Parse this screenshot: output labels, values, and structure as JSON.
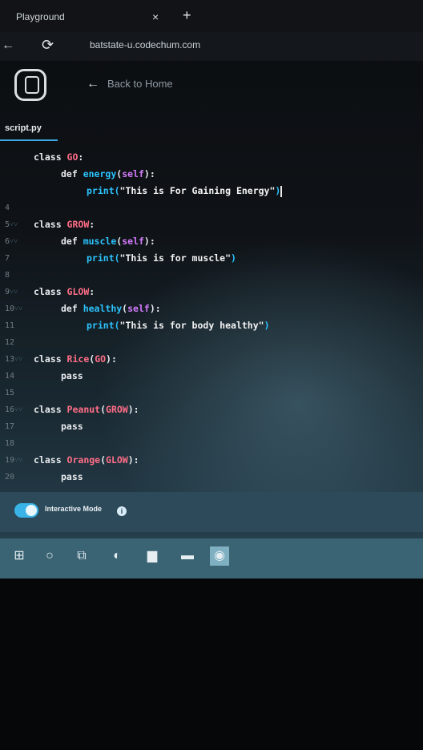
{
  "browser": {
    "tab_title": "Playground",
    "tab_close": "×",
    "new_tab": "+",
    "back": "←",
    "reload": "⟳",
    "url": "batstate-u.codechum.com"
  },
  "app": {
    "back_link_arrow": "←",
    "back_link_label": "Back to Home",
    "file_tab": "script.py"
  },
  "code_lines": [
    {
      "n": "",
      "fold": "",
      "parts": [
        {
          "t": "class ",
          "c": "kw"
        },
        {
          "t": "GO",
          "c": "cls"
        },
        {
          "t": ":",
          "c": "kw"
        }
      ],
      "indent": 0
    },
    {
      "n": "",
      "fold": "",
      "parts": [
        {
          "t": "def ",
          "c": "kw"
        },
        {
          "t": "energy",
          "c": "fn"
        },
        {
          "t": "(",
          "c": "kw"
        },
        {
          "t": "self",
          "c": "self"
        },
        {
          "t": "):",
          "c": "kw"
        }
      ],
      "indent": 1
    },
    {
      "n": "",
      "fold": "",
      "parts": [
        {
          "t": "print(",
          "c": "fn"
        },
        {
          "t": "\"This is For Gaining Energy\"",
          "c": "str"
        },
        {
          "t": ")",
          "c": "fn"
        }
      ],
      "indent": 2,
      "cursor": true
    },
    {
      "n": "4",
      "fold": "",
      "parts": [],
      "indent": 0
    },
    {
      "n": "5",
      "fold": "˅˅",
      "parts": [
        {
          "t": "class ",
          "c": "kw"
        },
        {
          "t": "GROW",
          "c": "cls"
        },
        {
          "t": ":",
          "c": "kw"
        }
      ],
      "indent": 0
    },
    {
      "n": "6",
      "fold": "˅˅",
      "parts": [
        {
          "t": "def ",
          "c": "kw"
        },
        {
          "t": "muscle",
          "c": "fn"
        },
        {
          "t": "(",
          "c": "kw"
        },
        {
          "t": "self",
          "c": "self"
        },
        {
          "t": "):",
          "c": "kw"
        }
      ],
      "indent": 1
    },
    {
      "n": "7",
      "fold": "",
      "parts": [
        {
          "t": "print(",
          "c": "fn"
        },
        {
          "t": "\"This is for muscle\"",
          "c": "str"
        },
        {
          "t": ")",
          "c": "fn"
        }
      ],
      "indent": 2
    },
    {
      "n": "8",
      "fold": "",
      "parts": [],
      "indent": 0
    },
    {
      "n": "9",
      "fold": "˅˅",
      "parts": [
        {
          "t": "class ",
          "c": "kw"
        },
        {
          "t": "GLOW",
          "c": "cls"
        },
        {
          "t": ":",
          "c": "kw"
        }
      ],
      "indent": 0
    },
    {
      "n": "10",
      "fold": "˅˅",
      "parts": [
        {
          "t": "def ",
          "c": "kw"
        },
        {
          "t": "healthy",
          "c": "fn"
        },
        {
          "t": "(",
          "c": "kw"
        },
        {
          "t": "self",
          "c": "self"
        },
        {
          "t": "):",
          "c": "kw"
        }
      ],
      "indent": 1
    },
    {
      "n": "11",
      "fold": "",
      "parts": [
        {
          "t": "print(",
          "c": "fn"
        },
        {
          "t": "\"This is for body healthy\"",
          "c": "str"
        },
        {
          "t": ")",
          "c": "fn"
        }
      ],
      "indent": 2
    },
    {
      "n": "12",
      "fold": "",
      "parts": [],
      "indent": 0
    },
    {
      "n": "13",
      "fold": "˅˅",
      "parts": [
        {
          "t": "class ",
          "c": "kw"
        },
        {
          "t": "Rice",
          "c": "cls"
        },
        {
          "t": "(",
          "c": "kw"
        },
        {
          "t": "GO",
          "c": "cls"
        },
        {
          "t": "):",
          "c": "kw"
        }
      ],
      "indent": 0
    },
    {
      "n": "14",
      "fold": "",
      "parts": [
        {
          "t": "pass",
          "c": "kw"
        }
      ],
      "indent": 1
    },
    {
      "n": "15",
      "fold": "",
      "parts": [],
      "indent": 0
    },
    {
      "n": "16",
      "fold": "˅˅",
      "parts": [
        {
          "t": "class ",
          "c": "kw"
        },
        {
          "t": "Peanut",
          "c": "cls"
        },
        {
          "t": "(",
          "c": "kw"
        },
        {
          "t": "GROW",
          "c": "cls"
        },
        {
          "t": "):",
          "c": "kw"
        }
      ],
      "indent": 0
    },
    {
      "n": "17",
      "fold": "",
      "parts": [
        {
          "t": "pass",
          "c": "kw"
        }
      ],
      "indent": 1
    },
    {
      "n": "18",
      "fold": "",
      "parts": [],
      "indent": 0
    },
    {
      "n": "19",
      "fold": "˅˅",
      "parts": [
        {
          "t": "class ",
          "c": "kw"
        },
        {
          "t": "Orange",
          "c": "cls"
        },
        {
          "t": "(",
          "c": "kw"
        },
        {
          "t": "GLOW",
          "c": "cls"
        },
        {
          "t": "):",
          "c": "kw"
        }
      ],
      "indent": 0
    },
    {
      "n": "20",
      "fold": "",
      "parts": [
        {
          "t": "pass",
          "c": "kw"
        }
      ],
      "indent": 1
    }
  ],
  "interactive_mode": {
    "label": "Interactive Mode",
    "enabled": true,
    "info_icon": "i"
  },
  "taskbar": {
    "items": [
      {
        "name": "windows-start-icon",
        "glyph": "⊞",
        "active": false
      },
      {
        "name": "search-circle-icon",
        "glyph": "○",
        "active": false
      },
      {
        "name": "task-view-icon",
        "glyph": "⧉",
        "active": false
      },
      {
        "name": "edge-browser-icon",
        "glyph": "◐",
        "active": false
      },
      {
        "name": "file-explorer-icon",
        "glyph": "▆",
        "active": false
      },
      {
        "name": "store-icon",
        "glyph": "▬",
        "active": false
      },
      {
        "name": "chrome-browser-icon",
        "glyph": "◉",
        "active": true
      }
    ]
  },
  "colors": {
    "accent": "#3ba7e0",
    "class_name": "#ff6e87",
    "function": "#2cc4ff",
    "self": "#d57cff"
  }
}
